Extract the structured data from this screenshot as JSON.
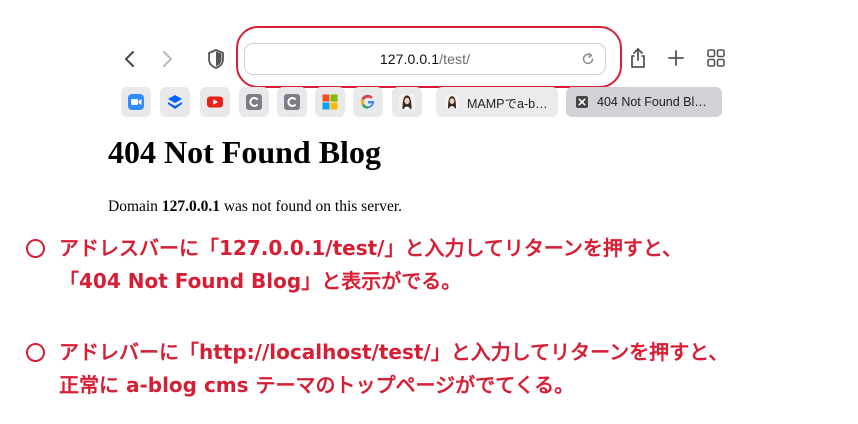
{
  "toolbar": {
    "address_host": "127.0.0.1",
    "address_path": "/test/",
    "back_icon": "chevron-left-icon",
    "forward_icon": "chevron-right-icon",
    "privacy_icon": "shield-icon",
    "reload_icon": "reload-icon",
    "share_icon": "share-icon",
    "new_tab_icon": "plus-icon",
    "tab_overview_icon": "grid-icon",
    "highlight_color": "#d61f35"
  },
  "favorites": [
    {
      "icon": "zoom-icon",
      "color": "#2d8cff"
    },
    {
      "icon": "dropbox-icon",
      "color": "#0061ff"
    },
    {
      "icon": "youtube-icon",
      "color": "#e62117"
    },
    {
      "icon": "c-letter-icon",
      "color": "#7d7d85"
    },
    {
      "icon": "c-letter-icon",
      "color": "#7d7d85"
    },
    {
      "icon": "microsoft-icon",
      "color": "#f25022"
    },
    {
      "icon": "google-icon",
      "color": "#4285f4"
    },
    {
      "icon": "avatar-icon",
      "color": "#444444"
    }
  ],
  "tabs": [
    {
      "label": "MAMPでa-b…",
      "icon": "avatar-icon"
    },
    {
      "label": "404 Not Found Bl…",
      "icon": "close-box-icon",
      "active": true
    }
  ],
  "page": {
    "title": "404 Not Found Blog",
    "body_prefix": "Domain ",
    "body_domain": "127.0.0.1",
    "body_suffix": " was not found on this server."
  },
  "notes": {
    "note1_line1": "アドレスバーに「127.0.0.1/test/」と入力してリターンを押すと、",
    "note1_line2": "「404 Not Found Blog」と表示がでる。",
    "note2_line1": "アドレバーに「http://localhost/test/」と入力してリターンを押すと、",
    "note2_line2": "正常に a-blog cms テーマのトップページがでてくる。",
    "color": "#d61f35"
  }
}
